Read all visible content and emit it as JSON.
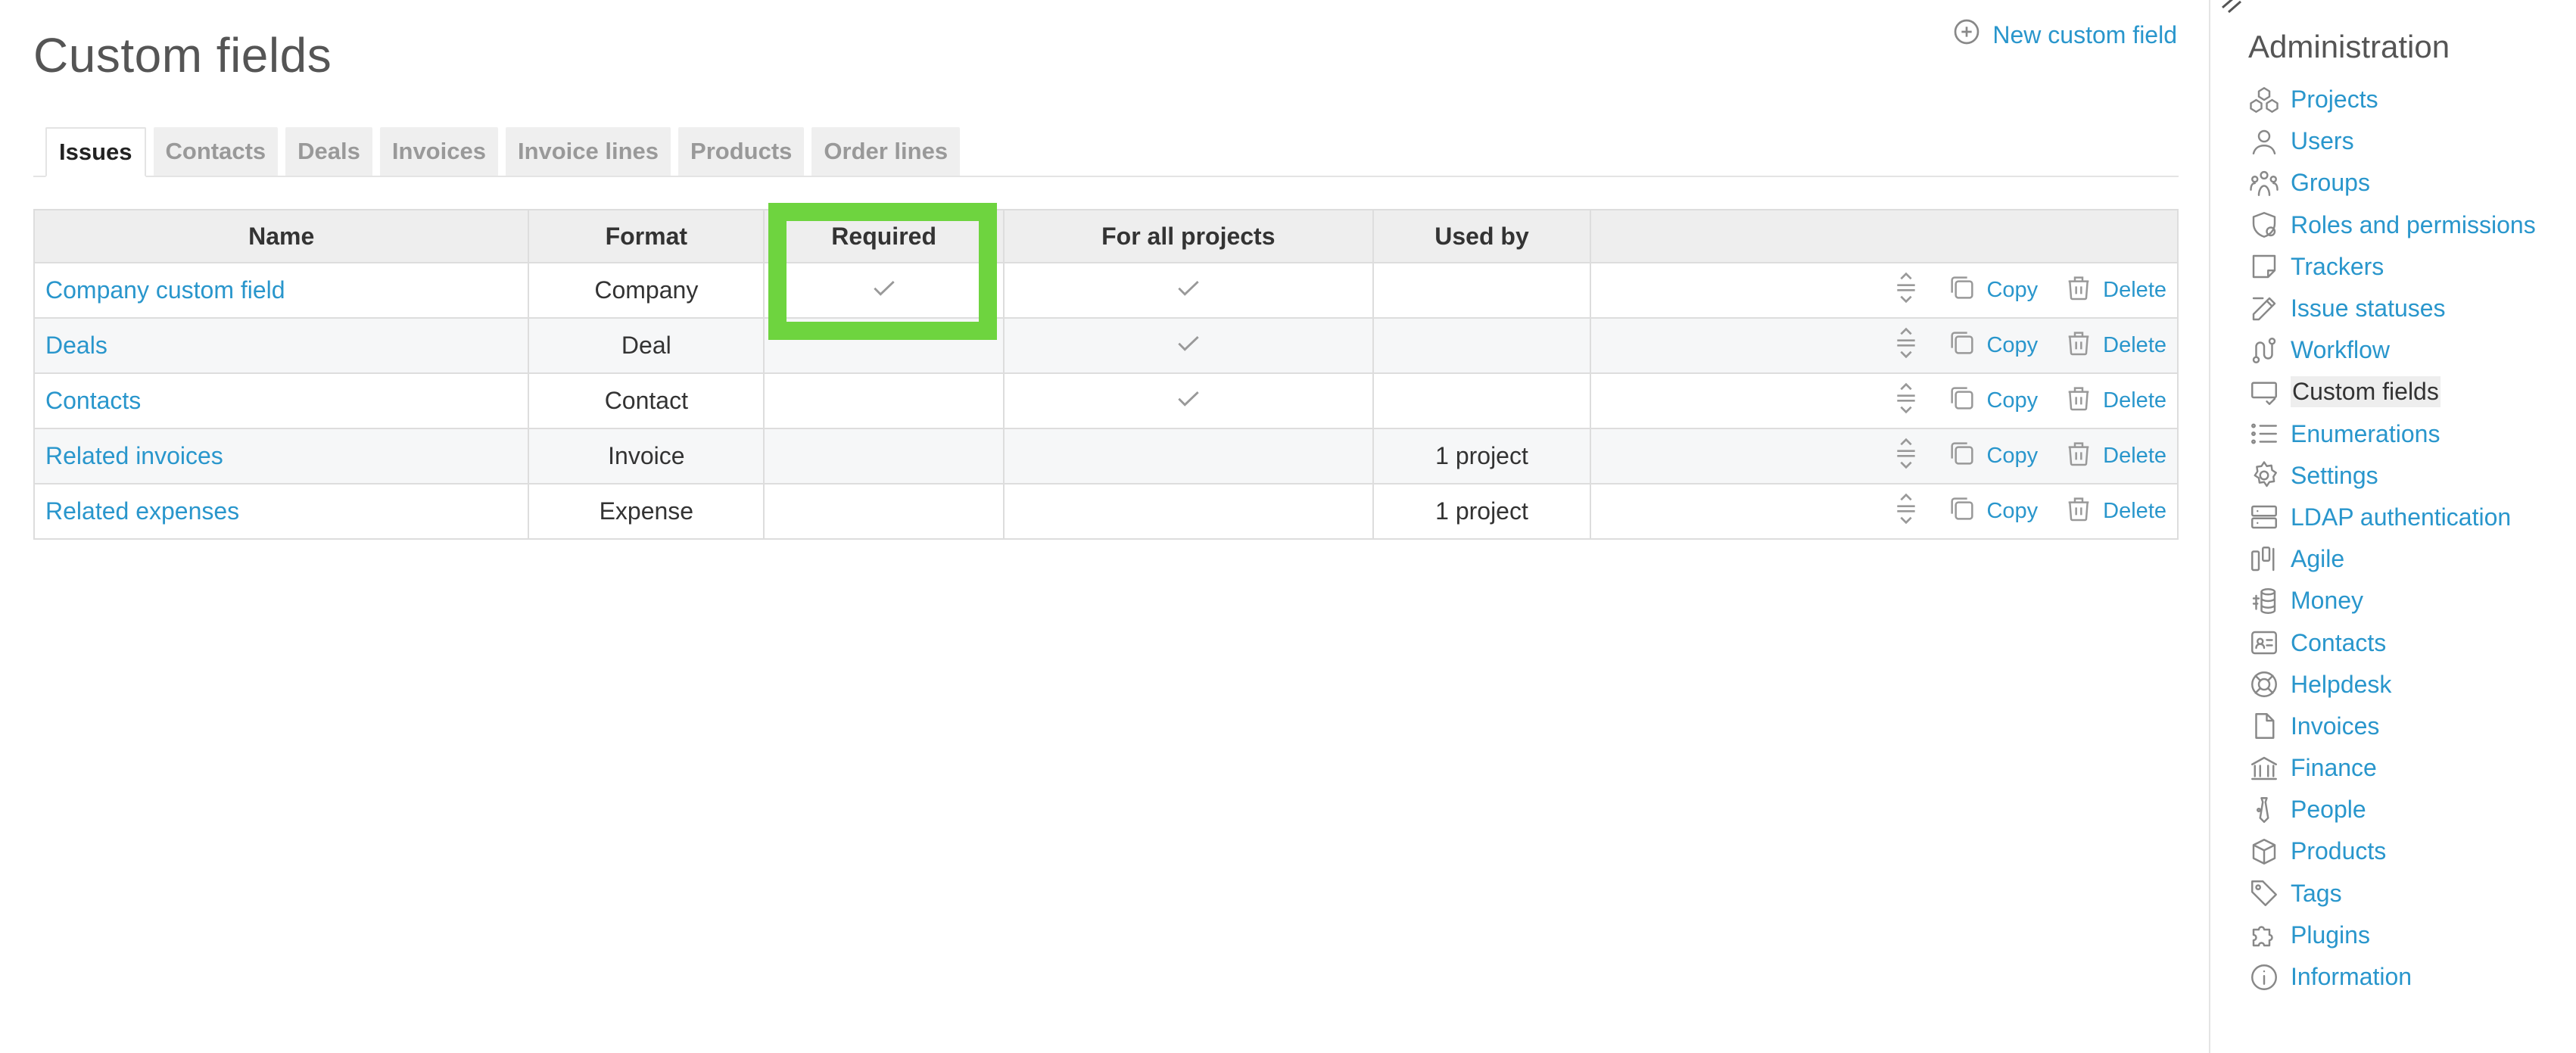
{
  "page": {
    "title": "Custom fields",
    "new_button_label": "New custom field"
  },
  "tabs": [
    {
      "label": "Issues",
      "active": true
    },
    {
      "label": "Contacts",
      "active": false
    },
    {
      "label": "Deals",
      "active": false
    },
    {
      "label": "Invoices",
      "active": false
    },
    {
      "label": "Invoice lines",
      "active": false
    },
    {
      "label": "Products",
      "active": false
    },
    {
      "label": "Order lines",
      "active": false
    }
  ],
  "table": {
    "columns": [
      "Name",
      "Format",
      "Required",
      "For all projects",
      "Used by",
      ""
    ],
    "rows": [
      {
        "name": "Company custom field",
        "format": "Company",
        "required": true,
        "for_all": true,
        "used_by": ""
      },
      {
        "name": "Deals",
        "format": "Deal",
        "required": false,
        "for_all": true,
        "used_by": ""
      },
      {
        "name": "Contacts",
        "format": "Contact",
        "required": false,
        "for_all": true,
        "used_by": ""
      },
      {
        "name": "Related invoices",
        "format": "Invoice",
        "required": false,
        "for_all": false,
        "used_by": "1 project"
      },
      {
        "name": "Related expenses",
        "format": "Expense",
        "required": false,
        "for_all": false,
        "used_by": "1 project"
      }
    ],
    "copy_label": "Copy",
    "delete_label": "Delete"
  },
  "sidebar": {
    "title": "Administration",
    "items": [
      {
        "label": "Projects",
        "icon": "projects-icon"
      },
      {
        "label": "Users",
        "icon": "user-icon"
      },
      {
        "label": "Groups",
        "icon": "groups-icon"
      },
      {
        "label": "Roles and permissions",
        "icon": "shield-icon"
      },
      {
        "label": "Trackers",
        "icon": "note-icon"
      },
      {
        "label": "Issue statuses",
        "icon": "edit-icon"
      },
      {
        "label": "Workflow",
        "icon": "workflow-icon"
      },
      {
        "label": "Custom fields",
        "icon": "custom-field-icon",
        "selected": true
      },
      {
        "label": "Enumerations",
        "icon": "list-icon"
      },
      {
        "label": "Settings",
        "icon": "gear-icon"
      },
      {
        "label": "LDAP authentication",
        "icon": "server-icon"
      },
      {
        "label": "Agile",
        "icon": "agile-icon"
      },
      {
        "label": "Money",
        "icon": "money-icon"
      },
      {
        "label": "Contacts",
        "icon": "contact-card-icon"
      },
      {
        "label": "Helpdesk",
        "icon": "lifebuoy-icon"
      },
      {
        "label": "Invoices",
        "icon": "document-icon"
      },
      {
        "label": "Finance",
        "icon": "bank-icon"
      },
      {
        "label": "People",
        "icon": "tie-icon"
      },
      {
        "label": "Products",
        "icon": "box-icon"
      },
      {
        "label": "Tags",
        "icon": "tag-icon"
      },
      {
        "label": "Plugins",
        "icon": "puzzle-icon"
      },
      {
        "label": "Information",
        "icon": "info-icon"
      }
    ]
  },
  "colors": {
    "link": "#2996cc",
    "highlight": "#6ed43f"
  }
}
